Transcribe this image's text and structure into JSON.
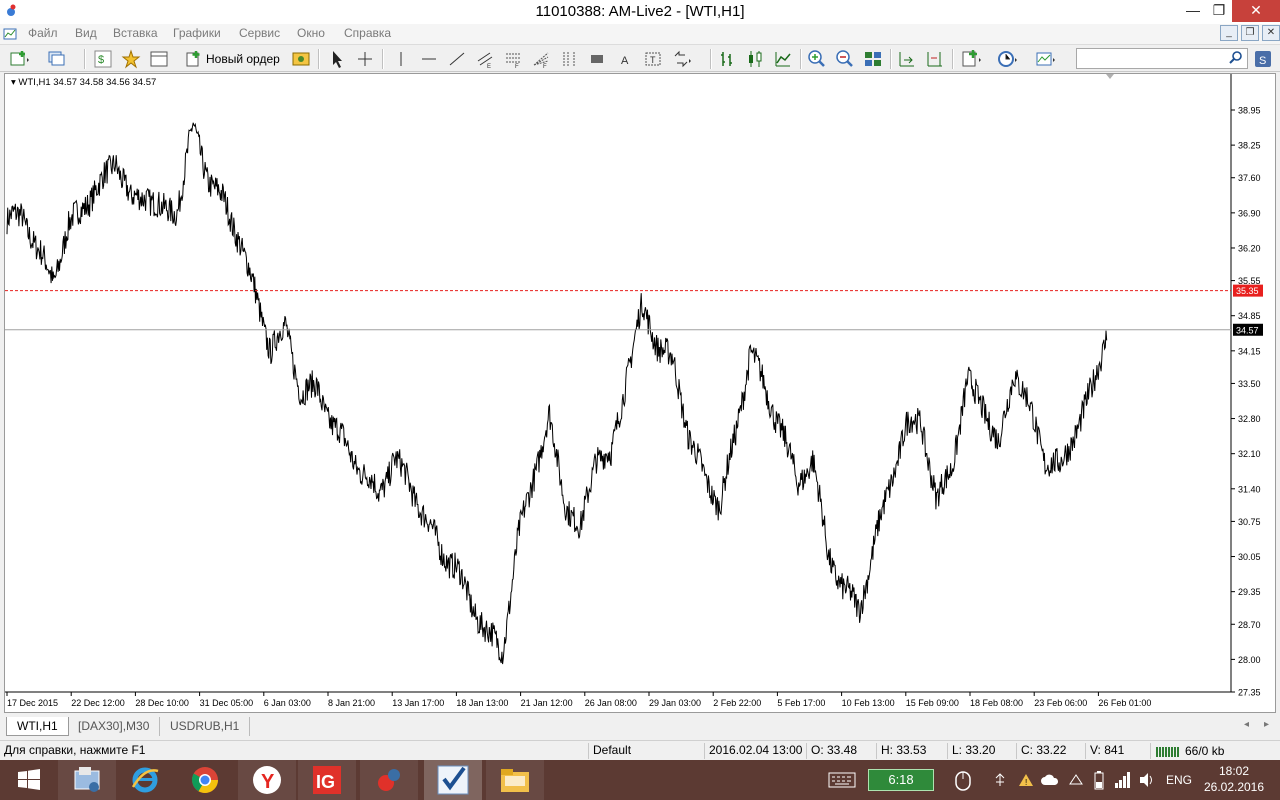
{
  "window": {
    "title": "11010388: AM-Live2 - [WTI,H1]",
    "minimize": "—",
    "restore": "❐",
    "close": "✕"
  },
  "menu": {
    "items": [
      "Файл",
      "Вид",
      "Вставка",
      "Графики",
      "Сервис",
      "Окно",
      "Справка"
    ]
  },
  "toolbar": {
    "new_order_label": "Новый ордер",
    "search_placeholder": ""
  },
  "chart": {
    "header": "WTI,H1  34.57 34.58 34.56 34.57",
    "price_levels": [
      "38.95",
      "38.25",
      "37.60",
      "36.90",
      "36.20",
      "35.55",
      "34.85",
      "34.15",
      "33.50",
      "32.80",
      "32.10",
      "31.40",
      "30.75",
      "30.05",
      "29.35",
      "28.70",
      "28.00",
      "27.35"
    ],
    "date_labels": [
      "17 Dec 2015",
      "22 Dec 12:00",
      "28 Dec 10:00",
      "31 Dec 05:00",
      "6 Jan 03:00",
      "8 Jan 21:00",
      "13 Jan 17:00",
      "18 Jan 13:00",
      "21 Jan 12:00",
      "26 Jan 08:00",
      "29 Jan 03:00",
      "2 Feb 22:00",
      "5 Feb 17:00",
      "10 Feb 13:00",
      "15 Feb 09:00",
      "18 Feb 08:00",
      "23 Feb 06:00",
      "26 Feb 01:00"
    ],
    "alert_price": "35.35",
    "current_price": "34.57",
    "alert_color": "#e8201e",
    "current_color": "#000000"
  },
  "chart_data": {
    "type": "line",
    "title": "WTI,H1",
    "y_range": [
      27.35,
      38.95
    ],
    "series": [
      {
        "name": "WTI,H1",
        "x": [
          "17 Dec 2015",
          "22 Dec 12:00",
          "28 Dec 10:00",
          "31 Dec 05:00",
          "6 Jan 03:00",
          "8 Jan 21:00",
          "13 Jan 17:00",
          "18 Jan 13:00",
          "21 Jan 12:00",
          "26 Jan 08:00",
          "29 Jan 03:00",
          "2 Feb 22:00",
          "5 Feb 17:00",
          "10 Feb 13:00",
          "15 Feb 09:00",
          "18 Feb 08:00",
          "23 Feb 06:00",
          "26 Feb 01:00"
        ],
        "values": [
          36.7,
          36.5,
          37.4,
          37.6,
          35.4,
          33.4,
          32.0,
          29.5,
          32.7,
          31.8,
          34.4,
          30.9,
          33.4,
          29.5,
          31.7,
          34.0,
          32.4,
          34.57
        ]
      }
    ],
    "horizontal_lines": [
      {
        "value": 35.35,
        "style": "dashed",
        "color": "#e8201e"
      },
      {
        "value": 34.57,
        "style": "solid",
        "color": "#a0a0a0"
      }
    ]
  },
  "tabs": [
    {
      "label": "WTI,H1",
      "active": true
    },
    {
      "label": "[DAX30],M30",
      "active": false
    },
    {
      "label": "USDRUB,H1",
      "active": false
    }
  ],
  "status": {
    "help": "Для справки, нажмите F1",
    "profile": "Default",
    "datetime": "2016.02.04 13:00",
    "open": "O: 33.48",
    "high": "H: 33.53",
    "low": "L: 33.20",
    "close": "C: 33.22",
    "volume": "V: 841",
    "traffic": "66/0 kb"
  },
  "taskbar": {
    "battery_time": "6:18",
    "language": "ENG",
    "time": "18:02",
    "date": "26.02.2016"
  }
}
